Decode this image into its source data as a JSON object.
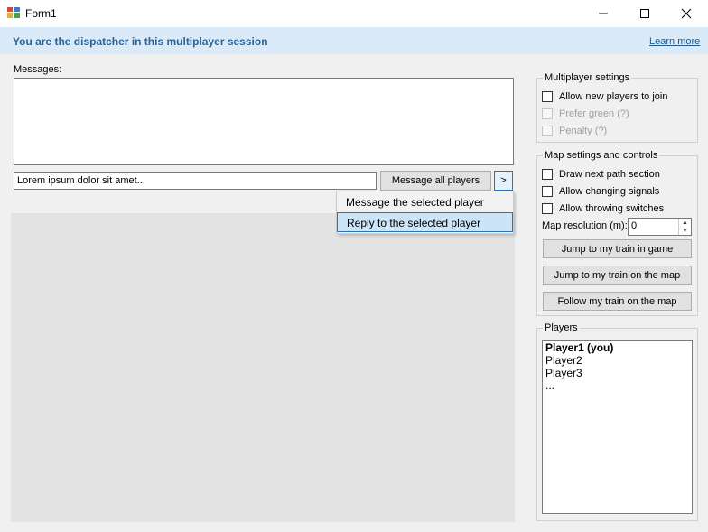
{
  "window": {
    "title": "Form1",
    "controls": {
      "minimize": "—",
      "maximize": "☐",
      "close": "✕"
    }
  },
  "banner": {
    "text": "You are the dispatcher in this multiplayer session",
    "link": "Learn more"
  },
  "messages": {
    "label": "Messages:",
    "input_value": "Lorem ipsum dolor sit amet...",
    "send_all_label": "Message all players",
    "more_label": ">"
  },
  "context_menu": {
    "items": [
      "Message the selected player",
      "Reply to the selected player"
    ],
    "highlighted_index": 1
  },
  "multiplayer_settings": {
    "title": "Multiplayer settings",
    "options": [
      {
        "label": "Allow new players to join",
        "checked": false,
        "enabled": true
      },
      {
        "label": "Prefer green (?)",
        "checked": false,
        "enabled": false
      },
      {
        "label": "Penalty (?)",
        "checked": false,
        "enabled": false
      }
    ]
  },
  "map_settings": {
    "title": "Map settings and controls",
    "options": [
      {
        "label": "Draw next path section",
        "checked": false
      },
      {
        "label": "Allow changing signals",
        "checked": false
      },
      {
        "label": "Allow throwing switches",
        "checked": false
      }
    ],
    "resolution_label": "Map resolution (m):",
    "resolution_value": "0",
    "buttons": [
      "Jump to my train in game",
      "Jump to my train on the map",
      "Follow my train on the map"
    ]
  },
  "players": {
    "title": "Players",
    "list": [
      "Player1 (you)",
      "Player2",
      "Player3",
      "..."
    ]
  },
  "colors": {
    "banner_bg": "#dbeaf8",
    "banner_text": "#2a6495",
    "highlight": "#cce4f7",
    "accent": "#2b73b8"
  }
}
